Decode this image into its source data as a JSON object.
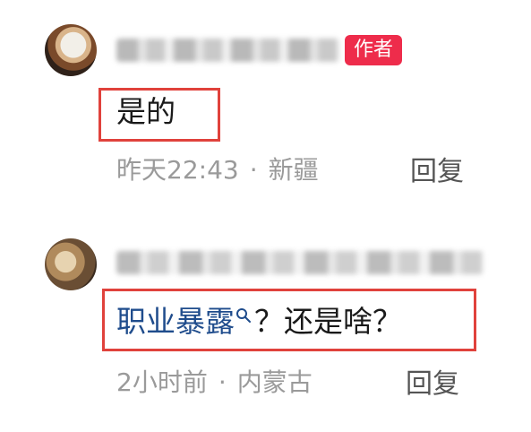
{
  "comments": [
    {
      "author_badge": "作者",
      "text": "是的",
      "time": "昨天22:43",
      "separator": "·",
      "location": "新疆",
      "reply_label": "回复"
    },
    {
      "text_link": "职业暴露",
      "text_rest": "？还是啥？",
      "time": "2小时前",
      "separator": "·",
      "location": "内蒙古",
      "reply_label": "回复"
    }
  ],
  "colors": {
    "badge": "#ee2c4b",
    "link": "#1f4c8c",
    "highlight": "#e0423c"
  }
}
